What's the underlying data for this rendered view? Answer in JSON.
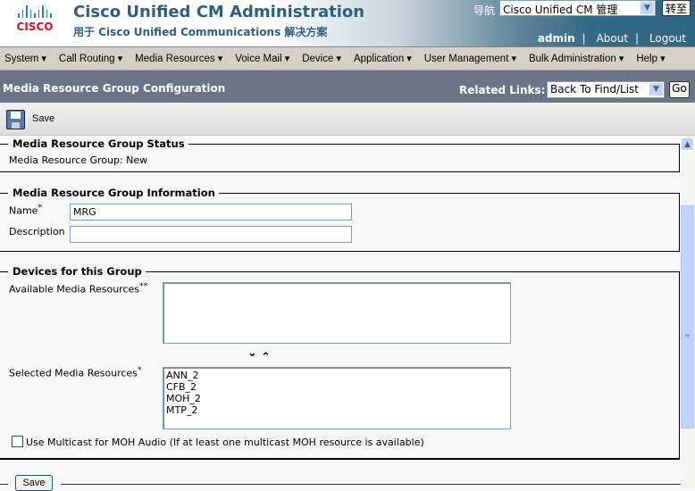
{
  "header": {
    "logo_text": "CISCO",
    "title": "Cisco Unified CM Administration",
    "subtitle": "用于 Cisco Unified Communications 解决方案",
    "nav_label": "导航",
    "nav_select": "Cisco Unified CM 管理",
    "goto_button": "转至",
    "user": "admin",
    "about": "About",
    "logout": "Logout"
  },
  "menu": [
    "System",
    "Call Routing",
    "Media Resources",
    "Voice Mail",
    "Device",
    "Application",
    "User Management",
    "Bulk Administration",
    "Help"
  ],
  "titlebar": {
    "title": "Media Resource Group Configuration",
    "related_links_label": "Related Links:",
    "related_links_value": "Back To Find/List",
    "go_button": "Go"
  },
  "toolbar": {
    "save_label": "Save"
  },
  "status": {
    "legend": "Media Resource Group Status",
    "text": "Media Resource Group: New"
  },
  "info": {
    "legend": "Media Resource Group Information",
    "name_label": "Name",
    "required_mark": "*",
    "name_value": "MRG",
    "description_label": "Description",
    "description_value": ""
  },
  "devices": {
    "legend": "Devices for this Group",
    "available_label": "Available Media Resources",
    "available_mark": "**",
    "available_items": [],
    "move_down": "⌄",
    "move_up": "⌃",
    "selected_label": "Selected Media Resources",
    "selected_mark": "*",
    "selected_items": [
      "ANN_2",
      "CFB_2",
      "MOH_2",
      "MTP_2"
    ],
    "multicast_label": "Use Multicast for MOH Audio (If at least one multicast MOH resource is available)",
    "multicast_checked": false
  },
  "footer": {
    "save_button": "Save"
  }
}
